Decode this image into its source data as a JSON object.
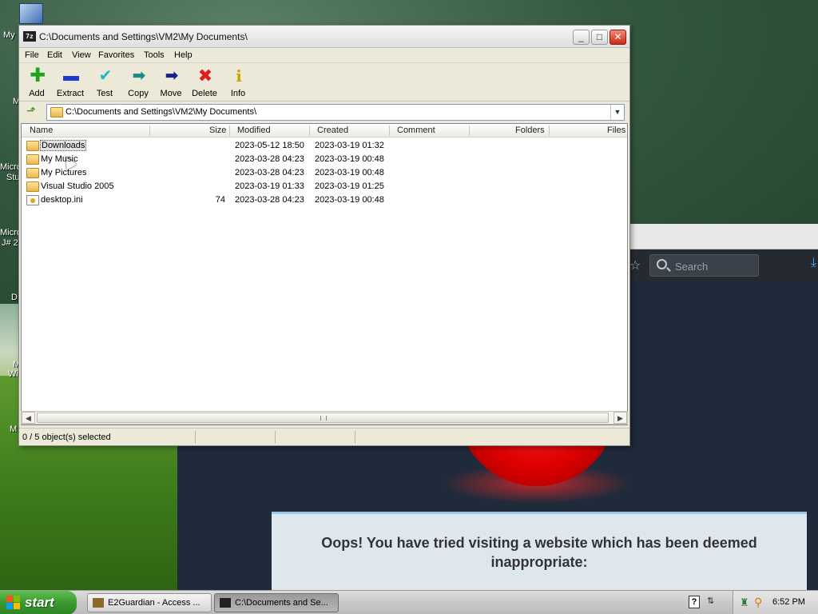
{
  "desktop": {
    "icons": [
      "My",
      "M",
      "Micro",
      "Stu",
      "Micro",
      "J# 2",
      "D",
      "M",
      "Wi",
      "M"
    ]
  },
  "browser": {
    "search_placeholder": "Search",
    "message": "Oops! You have tried visiting a website which has been deemed inappropriate:"
  },
  "window": {
    "title": "C:\\Documents and Settings\\VM2\\My Documents\\",
    "app_badge": "7z",
    "menu": [
      "File",
      "Edit",
      "View",
      "Favorites",
      "Tools",
      "Help"
    ],
    "toolbar": [
      {
        "label": "Add",
        "icon": "add-icon"
      },
      {
        "label": "Extract",
        "icon": "extract-icon"
      },
      {
        "label": "Test",
        "icon": "test-icon"
      },
      {
        "label": "Copy",
        "icon": "copy-icon"
      },
      {
        "label": "Move",
        "icon": "move-icon"
      },
      {
        "label": "Delete",
        "icon": "delete-icon"
      },
      {
        "label": "Info",
        "icon": "info-icon"
      }
    ],
    "address": "C:\\Documents and Settings\\VM2\\My Documents\\",
    "columns": [
      "Name",
      "Size",
      "Modified",
      "Created",
      "Comment",
      "Folders",
      "Files"
    ],
    "rows": [
      {
        "name": "Downloads",
        "size": "",
        "modified": "2023-05-12 18:50",
        "created": "2023-03-19 01:32",
        "type": "folder",
        "selected": true
      },
      {
        "name": "My Music",
        "size": "",
        "modified": "2023-03-28 04:23",
        "created": "2023-03-19 00:48",
        "type": "folder"
      },
      {
        "name": "My Pictures",
        "size": "",
        "modified": "2023-03-28 04:23",
        "created": "2023-03-19 00:48",
        "type": "folder"
      },
      {
        "name": "Visual Studio 2005",
        "size": "",
        "modified": "2023-03-19 01:33",
        "created": "2023-03-19 01:25",
        "type": "folder"
      },
      {
        "name": "desktop.ini",
        "size": "74",
        "modified": "2023-03-28 04:23",
        "created": "2023-03-19 00:48",
        "type": "file"
      }
    ],
    "status": "0 / 5 object(s) selected"
  },
  "taskbar": {
    "start_label": "start",
    "tasks": [
      {
        "label": "E2Guardian - Access ...",
        "active": false
      },
      {
        "label": "C:\\Documents and Se...",
        "active": true
      }
    ],
    "clock": "6:52 PM"
  },
  "colors": {
    "start_green": "#3a9a2e",
    "close_red": "#cc2b14",
    "browser_dark": "#1f2a3a"
  }
}
